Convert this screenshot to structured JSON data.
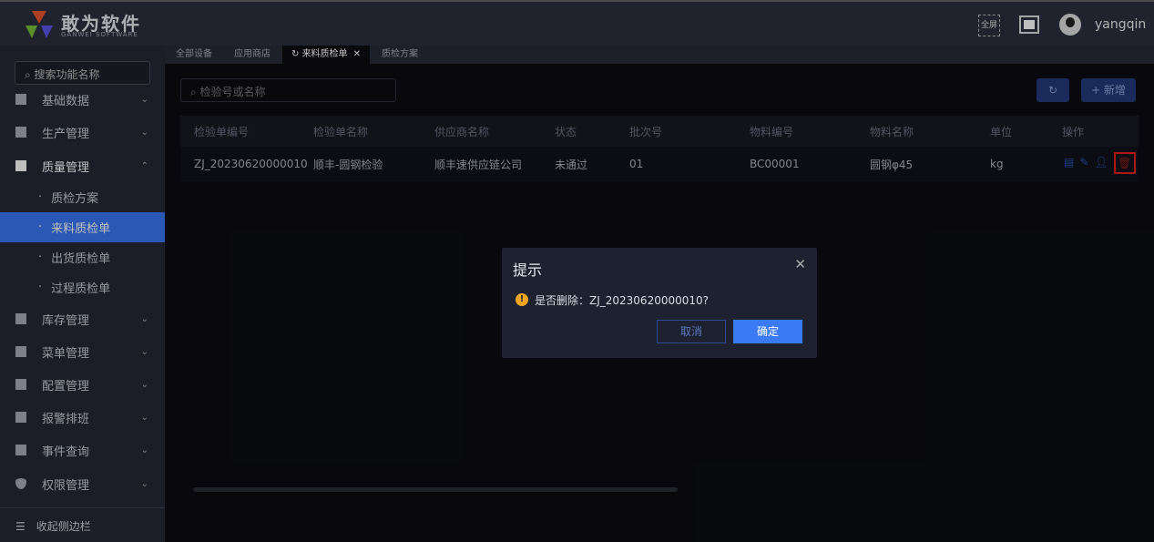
{
  "header": {
    "brand": "敢为软件",
    "brand_sub": "GANWEI SOFTWARE",
    "fullscreen_label": "全屏",
    "username": "yangqin"
  },
  "sidebar": {
    "search_placeholder": "搜索功能名称",
    "items": [
      {
        "label": "基础数据"
      },
      {
        "label": "生产管理"
      },
      {
        "label": "质量管理",
        "children": [
          "质检方案",
          "来料质检单",
          "出货质检单",
          "过程质检单"
        ]
      },
      {
        "label": "库存管理"
      },
      {
        "label": "菜单管理"
      },
      {
        "label": "配置管理"
      },
      {
        "label": "报警排班"
      },
      {
        "label": "事件查询"
      },
      {
        "label": "权限管理"
      }
    ],
    "collapse_label": "收起侧边栏"
  },
  "tabs": [
    "全部设备",
    "应用商店",
    "来料质检单",
    "质检方案"
  ],
  "main": {
    "search_placeholder": "检验号或名称",
    "add_label": "+ 新增",
    "columns": [
      "检验单编号",
      "检验单名称",
      "供应商名称",
      "状态",
      "批次号",
      "物料编号",
      "物料名称",
      "单位",
      "操作"
    ],
    "rows": [
      [
        "ZJ_20230620000010",
        "顺丰-圆钢检验",
        "顺丰速供应链公司",
        "未通过",
        "01",
        "BC00001",
        "圆钢φ45",
        "kg"
      ]
    ]
  },
  "dialog": {
    "title": "提示",
    "message": "是否删除：ZJ_20230620000010?",
    "cancel": "取消",
    "confirm": "确定"
  }
}
